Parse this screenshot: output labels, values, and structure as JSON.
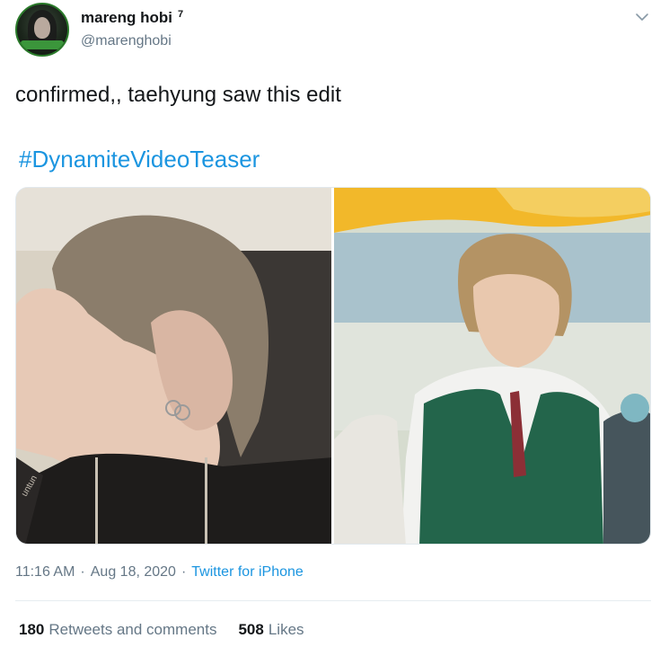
{
  "author": {
    "display_name": "mareng hobi",
    "badge": "7",
    "handle": "@marenghobi"
  },
  "tweet": {
    "text": "confirmed,, taehyung saw this edit",
    "hashtag": "#DynamiteVideoTeaser",
    "time": "11:16 AM",
    "separator": "·",
    "date": "Aug 18, 2020",
    "source": "Twitter for iPhone"
  },
  "stats": {
    "retweets_count": "180",
    "retweets_label": "Retweets and comments",
    "likes_count": "508",
    "likes_label": "Likes"
  },
  "media": {
    "left_photo_watermark": "untun"
  },
  "colors": {
    "link": "#1b95e0",
    "secondary_text": "#657786",
    "primary_text": "#14171a"
  },
  "icons": {
    "menu": "chevron-down-icon"
  }
}
